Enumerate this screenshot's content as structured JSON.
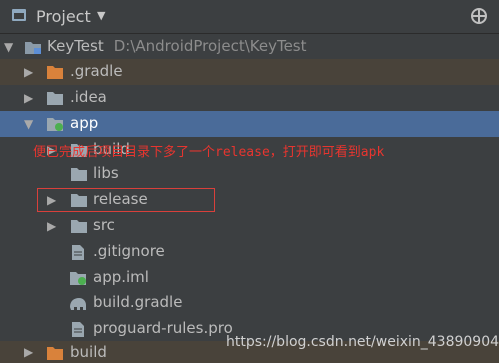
{
  "panel": {
    "title": "Project",
    "dropdown_glyph": "▼",
    "header_icon": "project-window-icon",
    "right_icon": "crosshair-icon"
  },
  "tree": {
    "root": {
      "name": "KeyTest",
      "path": "D:\\AndroidProject\\KeyTest",
      "expanded": true
    },
    "gradle": {
      "name": ".gradle",
      "expanded": false
    },
    "idea": {
      "name": ".idea",
      "expanded": false
    },
    "app": {
      "name": "app",
      "expanded": true
    },
    "app_build": {
      "name": "build",
      "expanded": false
    },
    "libs": {
      "name": "libs"
    },
    "release": {
      "name": "release",
      "expanded": false
    },
    "src": {
      "name": "src",
      "expanded": false
    },
    "gitignore": {
      "name": ".gitignore"
    },
    "app_iml": {
      "name": "app.iml"
    },
    "build_gradle": {
      "name": "build.gradle"
    },
    "proguard": {
      "name": "proguard-rules.pro"
    },
    "root_build": {
      "name": "build",
      "expanded": false
    }
  },
  "annotation": {
    "text": "便已完成后项目目录下多了一个release，打开即可看到apk"
  },
  "watermark": {
    "text": "https://blog.csdn.net/weixin_43890904"
  },
  "colors": {
    "background": "#3c3f41",
    "selection": "#4a6b99",
    "excluded_folder": "#49433a",
    "excluded_folder_icon": "#d9823b",
    "annotation_red": "#e8352f"
  }
}
